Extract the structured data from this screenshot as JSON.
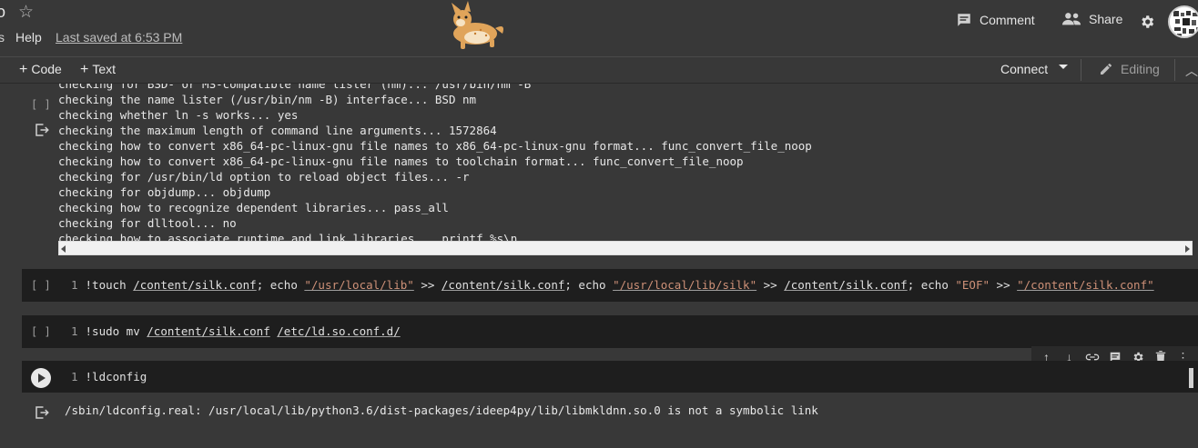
{
  "header": {
    "title_fragment": "o",
    "menu_fragment": "s",
    "menu_help": "Help",
    "last_saved": "Last saved at 6:53 PM",
    "comment_label": "Comment",
    "share_label": "Share"
  },
  "toolbar": {
    "add_code": "Code",
    "add_text": "Text",
    "connect": "Connect",
    "editing": "Editing"
  },
  "cell1": {
    "bracket": "[ ]",
    "output_lines": [
      "checking for BSD- or MS-compatible name lister (nm)... /usr/bin/nm -B",
      "checking the name lister (/usr/bin/nm -B) interface... BSD nm",
      "checking whether ln -s works... yes",
      "checking the maximum length of command line arguments... 1572864",
      "checking how to convert x86_64-pc-linux-gnu file names to x86_64-pc-linux-gnu format... func_convert_file_noop",
      "checking how to convert x86_64-pc-linux-gnu file names to toolchain format... func_convert_file_noop",
      "checking for /usr/bin/ld option to reload object files... -r",
      "checking for objdump... objdump",
      "checking how to recognize dependent libraries... pass_all",
      "checking for dlltool... no",
      "checking how to associate runtime and link libraries... printf %s\\n"
    ]
  },
  "cell2": {
    "bracket": "[ ]",
    "line_number": "1",
    "parts": {
      "cmd": "!touch ",
      "p1": "/content/silk.conf",
      "t1": "; echo ",
      "s1": "\"/usr/local/lib\"",
      "t2": " >> ",
      "p2": "/content/silk.conf",
      "t3": "; echo ",
      "s2": "\"/usr/local/lib/silk\"",
      "t4": " >> ",
      "p3": "/content/silk.conf",
      "t5": "; echo ",
      "s3": "\"EOF\"",
      "t6": " >> ",
      "s4": "\"/content/silk.conf\""
    }
  },
  "cell3": {
    "bracket": "[ ]",
    "line_number": "1",
    "parts": {
      "cmd": "!sudo mv ",
      "p1": "/content/silk.conf",
      "sp": " ",
      "p2": "/etc/ld.so.conf.d/"
    }
  },
  "cell4": {
    "line_number": "1",
    "code": "!ldconfig",
    "output": "/sbin/ldconfig.real: /usr/local/lib/python3.6/dist-packages/ideep4py/lib/libmkldnn.so.0 is not a symbolic link"
  },
  "icons": {
    "star": "star-icon",
    "comment": "comment-icon",
    "share": "people-icon",
    "settings": "gear-icon",
    "editing": "pencil-icon",
    "output": "output-arrow-icon",
    "run": "play-icon"
  },
  "colors": {
    "background": "#383838",
    "code_cell": "#1e1e1e",
    "string": "#ce9178"
  }
}
